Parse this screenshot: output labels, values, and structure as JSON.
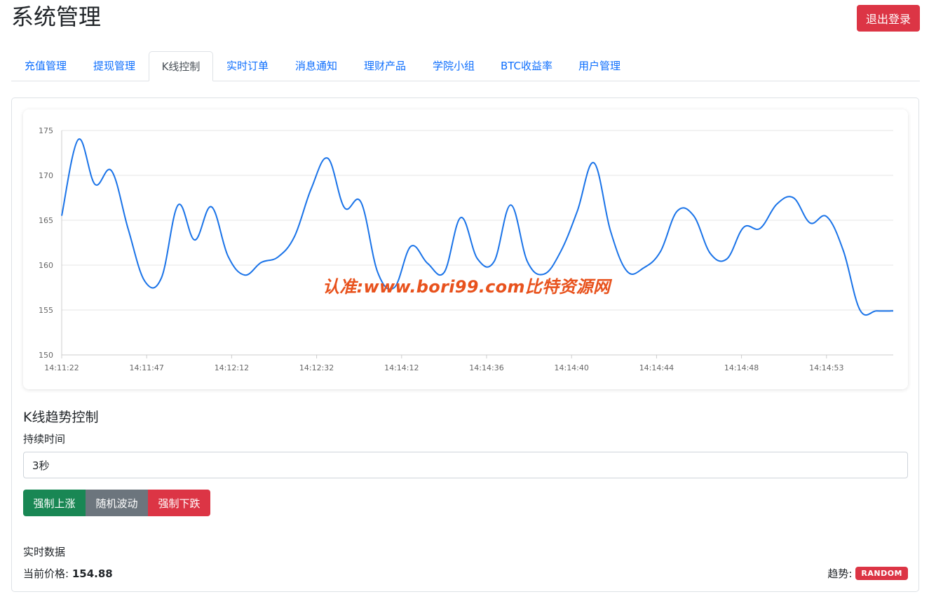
{
  "header": {
    "title": "系统管理",
    "logout_label": "退出登录"
  },
  "tabs": [
    {
      "label": "充值管理"
    },
    {
      "label": "提现管理"
    },
    {
      "label": "K线控制"
    },
    {
      "label": "实时订单"
    },
    {
      "label": "消息通知"
    },
    {
      "label": "理财产品"
    },
    {
      "label": "学院小组"
    },
    {
      "label": "BTC收益率"
    },
    {
      "label": "用户管理"
    }
  ],
  "active_tab": "K线控制",
  "watermark": "认准:www.bori99.com比特资源网",
  "chart_data": {
    "type": "line",
    "title": "",
    "xlabel": "",
    "ylabel": "",
    "ylim": [
      150,
      175
    ],
    "yticks": [
      150,
      155,
      160,
      165,
      170,
      175
    ],
    "grid": true,
    "x_tick_labels": [
      "14:11:22",
      "14:11:47",
      "14:12:12",
      "14:12:32",
      "14:14:12",
      "14:14:36",
      "14:14:40",
      "14:14:44",
      "14:14:48",
      "14:14:53"
    ],
    "line_color": "#1a73e8",
    "values": [
      165.5,
      174.0,
      169.0,
      170.5,
      164.0,
      158.2,
      158.6,
      166.7,
      162.8,
      166.5,
      161.0,
      158.9,
      160.3,
      160.9,
      163.2,
      168.5,
      171.9,
      166.4,
      167.0,
      159.2,
      157.5,
      162.1,
      160.2,
      159.2,
      165.3,
      160.7,
      160.4,
      166.7,
      160.4,
      159.0,
      161.5,
      166.0,
      171.4,
      163.8,
      159.3,
      159.7,
      161.5,
      166.0,
      165.5,
      161.3,
      160.7,
      164.2,
      164.1,
      166.8,
      167.5,
      164.7,
      165.4,
      161.6,
      155.0,
      154.9,
      154.9
    ]
  },
  "control": {
    "section_title": "K线趋势控制",
    "duration_label": "持续时间",
    "duration_value": "3秒",
    "buttons": {
      "up": "强制上涨",
      "random": "随机波动",
      "down": "强制下跌"
    }
  },
  "realtime": {
    "title": "实时数据",
    "price_label": "当前价格:",
    "price_value": "154.88",
    "trend_label": "趋势:",
    "trend_value": "RANDOM"
  },
  "colors": {
    "primary": "#0d6efd",
    "danger": "#dc3545",
    "success": "#198754",
    "secondary": "#6c757d",
    "watermark": "#e8521d"
  }
}
